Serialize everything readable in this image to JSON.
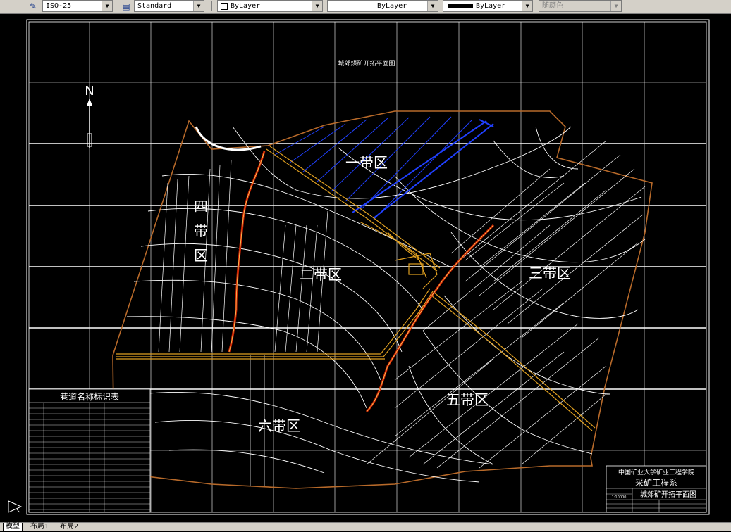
{
  "toolbar": {
    "dimstyle": "ISO-25",
    "tablestyle": "Standard",
    "layer": "ByLayer",
    "linetype": "ByLayer",
    "lineweight": "ByLayer",
    "plotstyle": "随颜色"
  },
  "drawing": {
    "title": "城郊煤矿开拓平面图",
    "north": "N",
    "zones": {
      "zone1": "一带区",
      "zone2": "二带区",
      "zone3": "三带区",
      "zone4": [
        "四",
        "带",
        "区"
      ],
      "zone5": "五带区",
      "zone6": "六带区"
    }
  },
  "legend_table": {
    "title": "巷道名称标识表"
  },
  "title_block": {
    "school": "中国矿业大学矿业工程学院",
    "department": "采矿工程系",
    "scale_value": "1:10000",
    "drawing_name": "城郊矿开拓平面图"
  },
  "tabs": [
    "模型",
    "布局1",
    "布局2"
  ],
  "colors": {
    "background": "#000000",
    "lines": "#ffffff",
    "roadway": "#e0a020",
    "fault": "#cc2200",
    "blue_roadway": "#2040ff",
    "boundary": "#b86a2a"
  }
}
